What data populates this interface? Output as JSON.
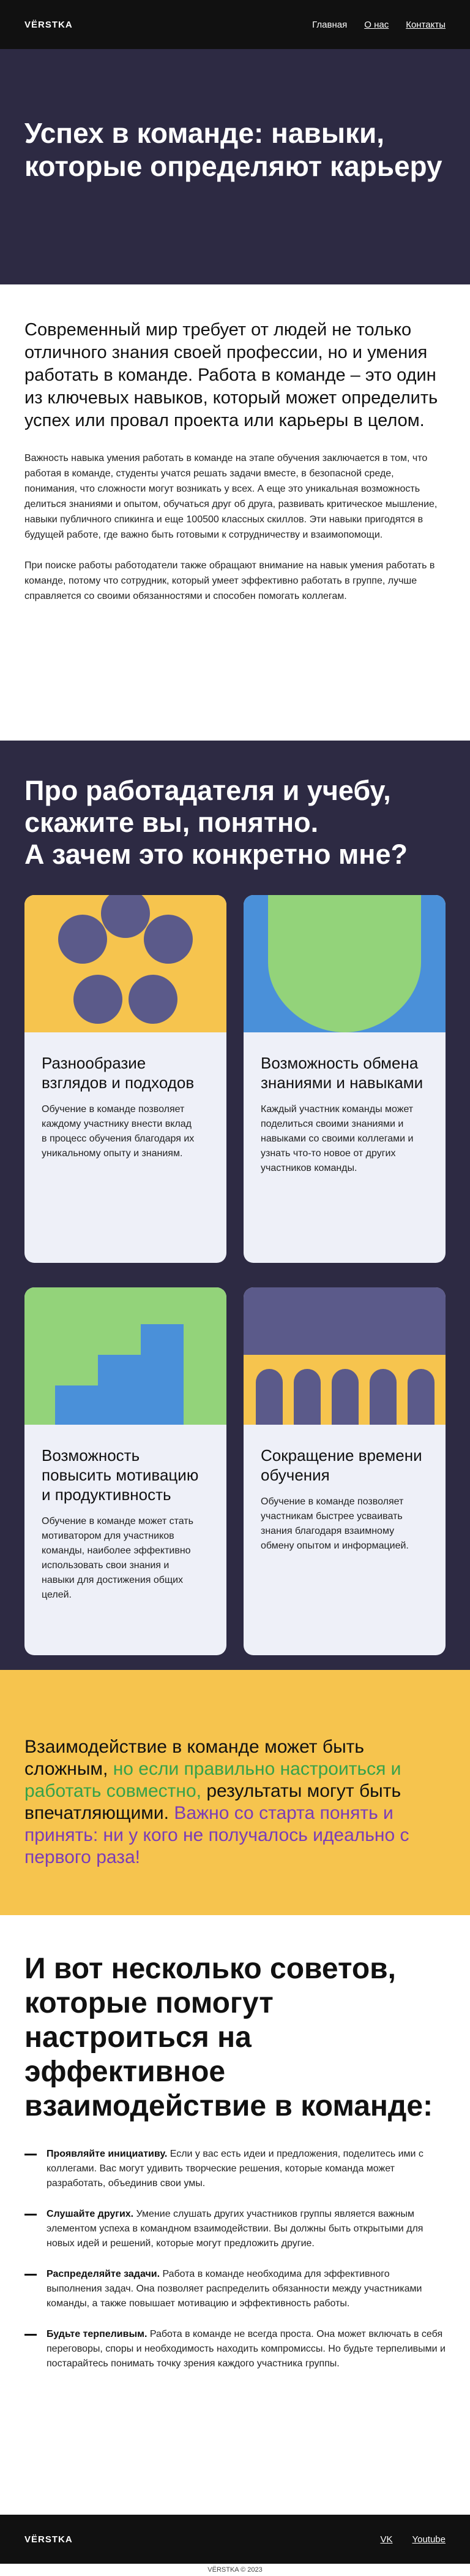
{
  "header": {
    "logo": "VЁRSTKA",
    "nav": [
      "Главная",
      "О нас",
      "Контакты"
    ]
  },
  "hero": {
    "title": "Успех в команде: навыки, которые определяют карьеру"
  },
  "intro": {
    "lead": "Современный мир требует от людей не только отличного знания своей профессии, но и умения работать в команде. Работа в команде – это один из ключевых навыков, который может определить успех или провал проекта или карьеры в целом.",
    "paragraph1": "Важность навыка умения работать в команде на этапе обучения заключается в том, что работая в команде, студенты учатся решать задачи вместе, в безопасной среде, понимания, что сложности могут возникать у всех. А еще это уникальная возможность делиться знаниями и опытом, обучаться друг об друга, развивать критическое мышление, навыки публичного спикинга и еще 100500 классных скиллов. Эти навыки пригодятся в будущей работе, где важно быть готовыми к сотрудничеству и взаимопомощи.",
    "paragraph2": "При поиске работы работодатели также обращают внимание на навык умения работать в команде, потому что сотрудник, который умеет эффективно работать в группе, лучше справляется со своими обязанностями и способен помогать коллегам."
  },
  "reasons": {
    "title_line1": "Про работадателя и учебу,",
    "title_line2": "скажите вы, понятно.",
    "title_line3": "А зачем это конкретно мне?",
    "cards": [
      {
        "title": "Разнообразие взглядов и подходов",
        "text": "Обучение в команде позволяет каждому участнику внести вклад в процесс обучения благодаря их уникальному опыту и знаниям."
      },
      {
        "title": "Возможность обмена знаниями и навыками",
        "text": "Каждый участник команды может поделиться своими знаниями и навыками со своими коллегами и узнать что-то новое от других участников команды."
      },
      {
        "title": "Возможность повысить мотивацию и продуктивность",
        "text": "Обучение в команде может стать мотиватором для участников команды, наиболее эффективно использовать свои знания и навыки для достижения общих целей."
      },
      {
        "title": "Сокращение времени обучения",
        "text": "Обучение в команде позволяет участникам быстрее усваивать знания благодаря взаимному обмену опытом и информацией."
      }
    ]
  },
  "highlight": {
    "part1": "Взаимодействие в команде может быть сложным, ",
    "part2": "но если правильно настроиться и работать совместно,",
    "part3": " результаты могут быть впечатляющими. ",
    "part4": "Важно со старта понять и принять: ни у кого не получалось идеально с первого раза!"
  },
  "tips": {
    "title": "И вот несколько советов, которые помогут настроиться на эффективное взаимодействие в команде:",
    "items": [
      {
        "bold": "Проявляйте инициативу.",
        "text": " Если у вас есть идеи и предложения, поделитесь ими с коллегами. Вас могут удивить творческие решения, которые команда может разработать, объединив свои умы."
      },
      {
        "bold": "Слушайте других.",
        "text": " Умение слушать других участников группы является важным элементом успеха в командном взаимодействии. Вы должны быть открытыми для новых идей и решений, которые могут предложить другие."
      },
      {
        "bold": "Распределяйте задачи.",
        "text": " Работа в команде необходима для эффективного выполнения задач. Она позволяет распределить обязанности между участниками команды, а также повышает мотивацию и эффективность работы."
      },
      {
        "bold": "Будьте терпеливым.",
        "text": " Работа в команде не всегда проста. Она может включать в себя переговоры, споры и необходимость находить компромиссы. Но будьте терпеливыми и постарайтесь понимать точку зрения каждого участника группы."
      }
    ]
  },
  "footer": {
    "logo": "VЁRSTKA",
    "links": [
      "VK",
      "Youtube"
    ],
    "copyright": "VЁRSTKA © 2023"
  },
  "colors": {
    "dark": "#2d2a43",
    "black": "#111111",
    "yellow": "#f6c44e",
    "purple_shape": "#5b5a8a",
    "blue": "#4a90d9",
    "green": "#93d37a",
    "card_bg": "#eef0f8",
    "text_green": "#35a24a",
    "text_purple": "#7b3cb8"
  }
}
